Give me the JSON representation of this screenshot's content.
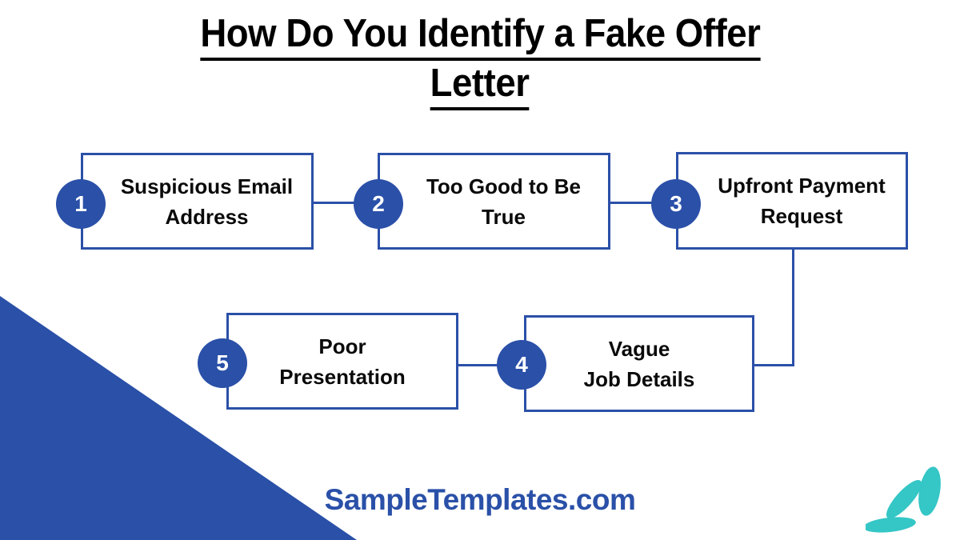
{
  "title": {
    "line1": "How Do You Identify a Fake Offer",
    "line2": "Letter",
    "full": "How Do You Identify a Fake Offer Letter"
  },
  "brand": {
    "text": "SampleTemplates.com"
  },
  "colors": {
    "primary_blue": "#2A50A8",
    "accent_teal": "#35C6C6",
    "text_black": "#0A0A0A",
    "background": "#FFFFFF"
  },
  "steps": [
    {
      "number": "1",
      "label": "Suspicious Email\nAddress"
    },
    {
      "number": "2",
      "label": "Too Good to Be\nTrue"
    },
    {
      "number": "3",
      "label": "Upfront Payment\nRequest"
    },
    {
      "number": "4",
      "label": "Vague\nJob Details"
    },
    {
      "number": "5",
      "label": "Poor\nPresentation"
    }
  ],
  "decorations": {
    "corner_triangle": "blue-corner-triangle",
    "leaf_cluster": "teal-leaf-cluster"
  }
}
